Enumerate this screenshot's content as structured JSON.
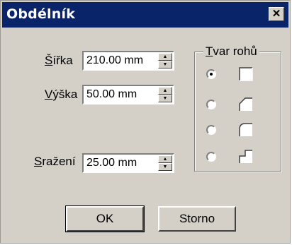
{
  "window": {
    "title": "Obdélník",
    "close_glyph": "✕"
  },
  "fields": {
    "width": {
      "label_u": "Š",
      "label_rest": "ířka",
      "value": "210.00 mm"
    },
    "height": {
      "label_u": "V",
      "label_rest": "ýška",
      "value": "50.00 mm"
    },
    "chamfer": {
      "label_u": "S",
      "label_rest": "ražení",
      "value": "25.00 mm"
    }
  },
  "corner_shape": {
    "label_u": "T",
    "label_rest": "var rohů",
    "options": [
      {
        "icon": "square-corner-icon",
        "selected": true
      },
      {
        "icon": "chamfer-corner-icon",
        "selected": false
      },
      {
        "icon": "rounded-corner-icon",
        "selected": false
      },
      {
        "icon": "inverted-corner-icon",
        "selected": false
      }
    ]
  },
  "buttons": {
    "ok": "OK",
    "cancel": "Storno"
  }
}
